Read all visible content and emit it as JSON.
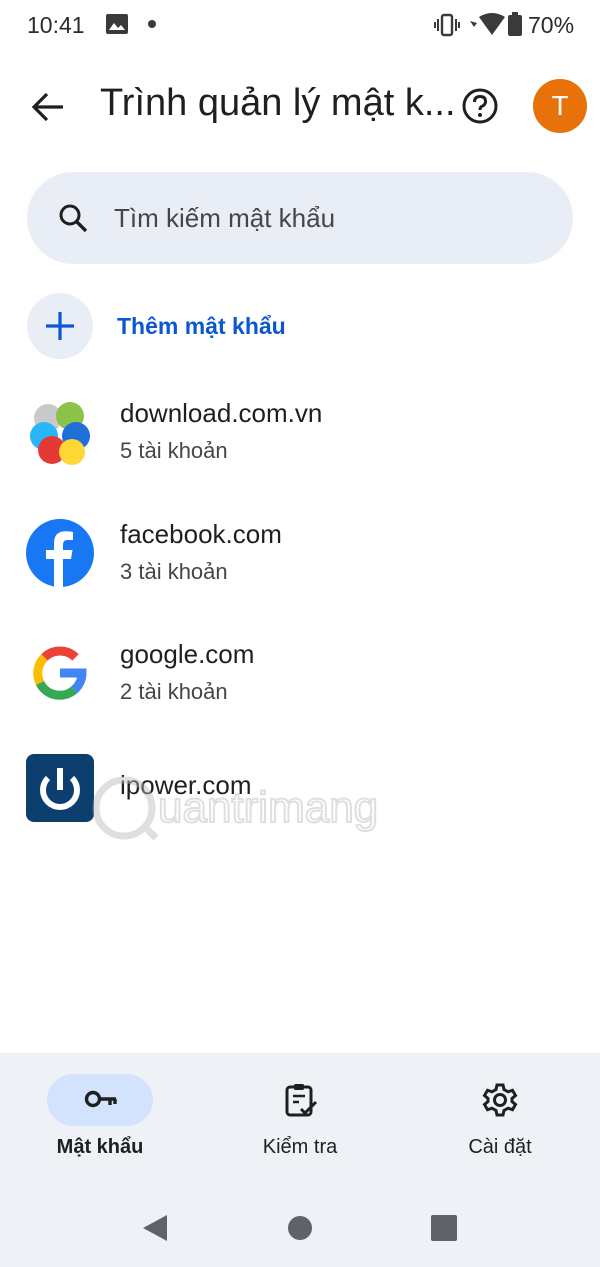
{
  "status_bar": {
    "time": "10:41",
    "battery": "70%"
  },
  "app_bar": {
    "title": "Trình quản lý mật k...",
    "avatar_letter": "T"
  },
  "search": {
    "placeholder": "Tìm kiếm mật khẩu"
  },
  "add_password": {
    "label": "Thêm mật khẩu"
  },
  "sites": [
    {
      "domain": "download.com.vn",
      "count": "5 tài khoản",
      "icon": "download-com-vn-logo"
    },
    {
      "domain": "facebook.com",
      "count": "3 tài khoản",
      "icon": "facebook-logo"
    },
    {
      "domain": "google.com",
      "count": "2 tài khoản",
      "icon": "google-logo"
    },
    {
      "domain": "ipower.com",
      "count": "",
      "icon": "ipower-logo"
    }
  ],
  "watermark": {
    "text": "uantrimang"
  },
  "bottom_nav": {
    "items": [
      {
        "label": "Mật khẩu",
        "icon": "key-icon",
        "active": true
      },
      {
        "label": "Kiểm tra",
        "icon": "clipboard-check-icon",
        "active": false
      },
      {
        "label": "Cài đặt",
        "icon": "gear-icon",
        "active": false
      }
    ]
  },
  "colors": {
    "accent": "#0b57d0",
    "avatar": "#e8710a",
    "surface": "#e9eef6",
    "nav_active": "#d3e3fd"
  }
}
